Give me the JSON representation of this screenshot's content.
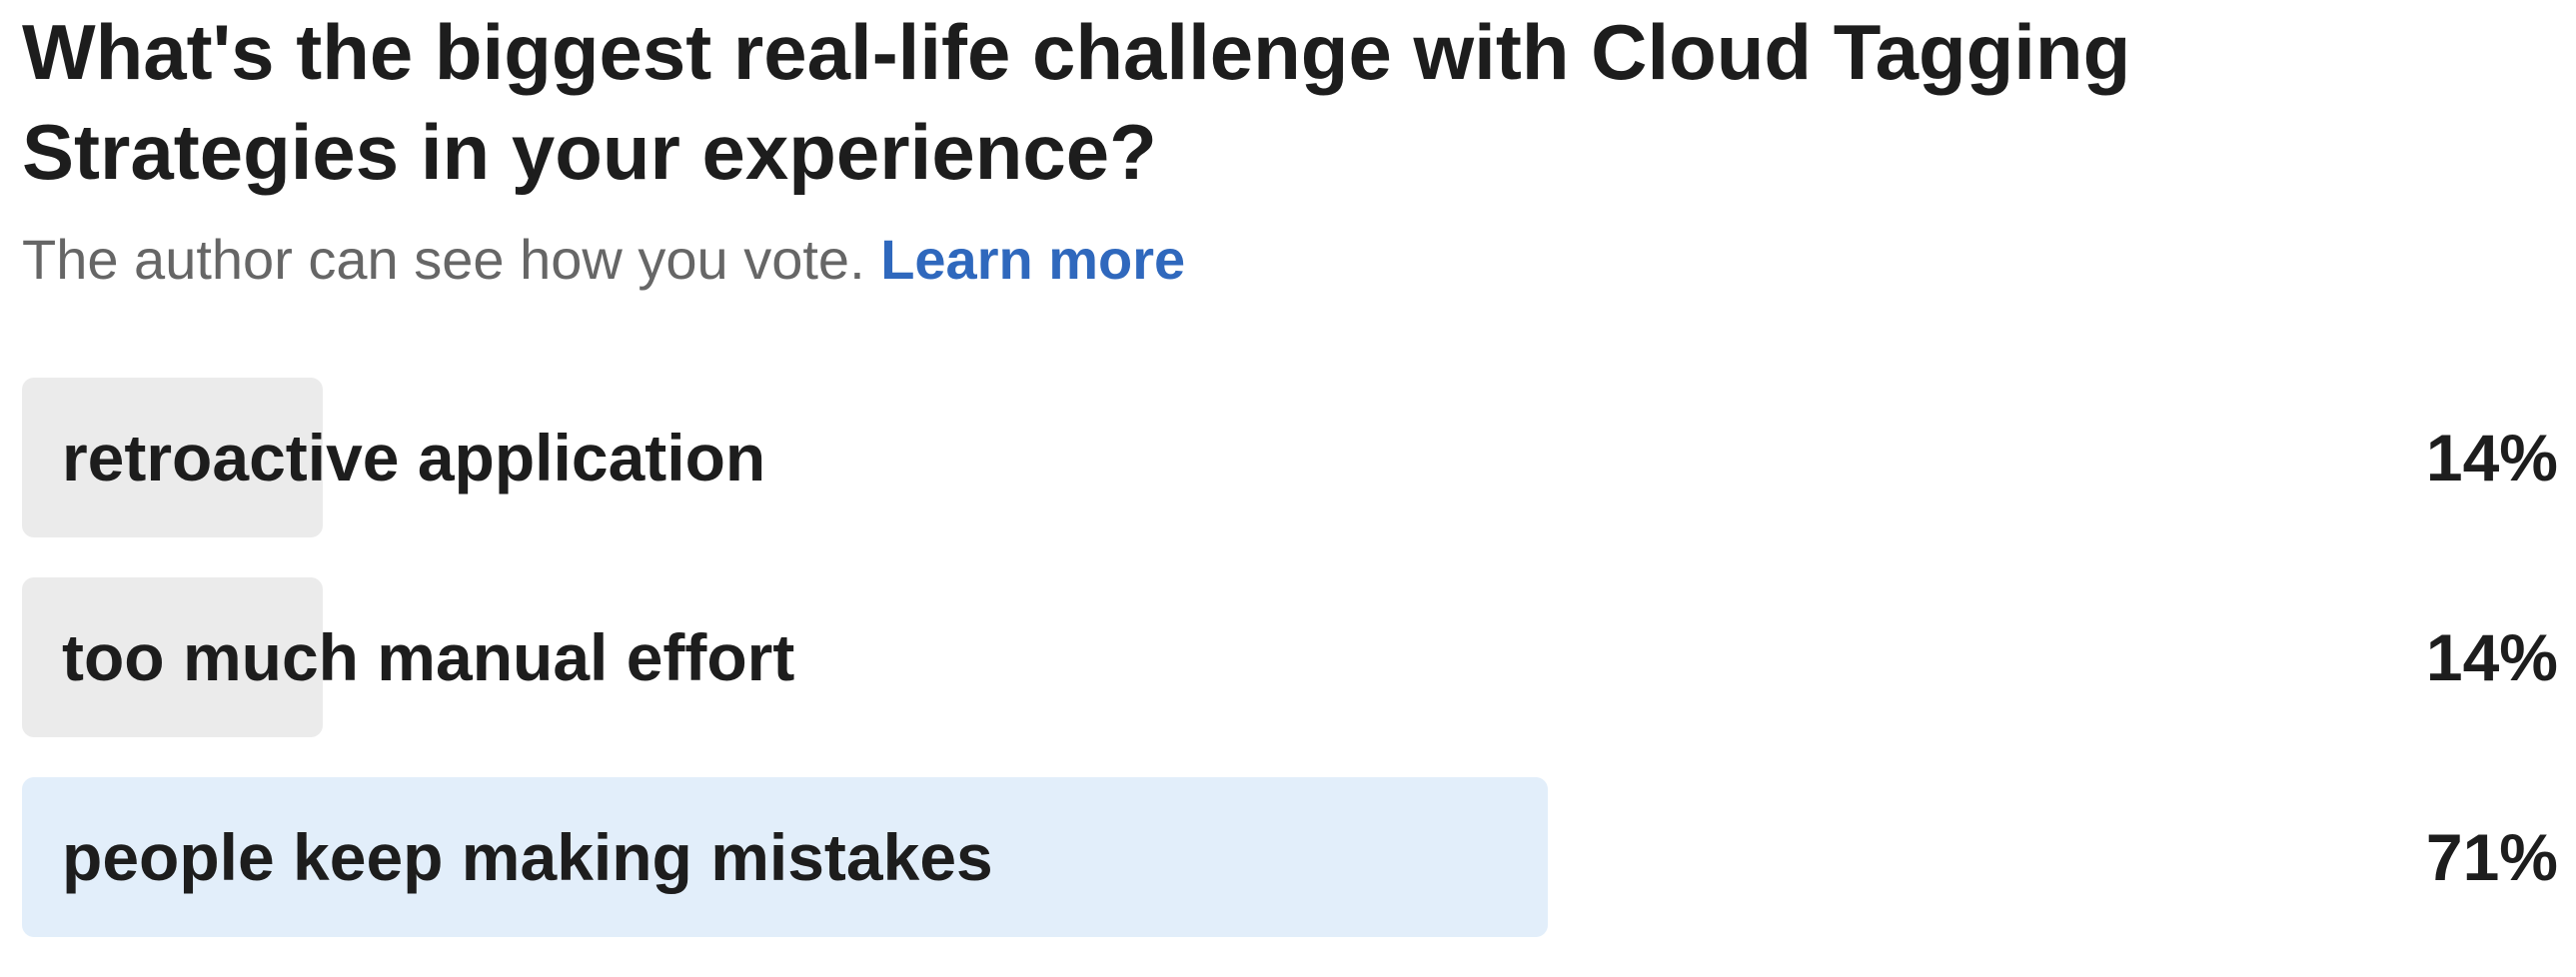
{
  "poll": {
    "question": "What's the biggest real-life challenge with Cloud Tagging Strategies in your experience?",
    "notice": "The author can see how you vote.",
    "learn_more": "Learn more",
    "options": [
      {
        "label": "retroactive application",
        "percent": "14%",
        "share": 0.14,
        "leading": false
      },
      {
        "label": "too much manual effort",
        "percent": "14%",
        "share": 0.14,
        "leading": false
      },
      {
        "label": "people keep making mistakes",
        "percent": "71%",
        "share": 0.71,
        "leading": true
      }
    ]
  },
  "colors": {
    "text": "#1d1d1d",
    "muted": "#666666",
    "link": "#2f68bd",
    "bar_default": "#ebebeb",
    "bar_leading": "#e2eefa"
  }
}
